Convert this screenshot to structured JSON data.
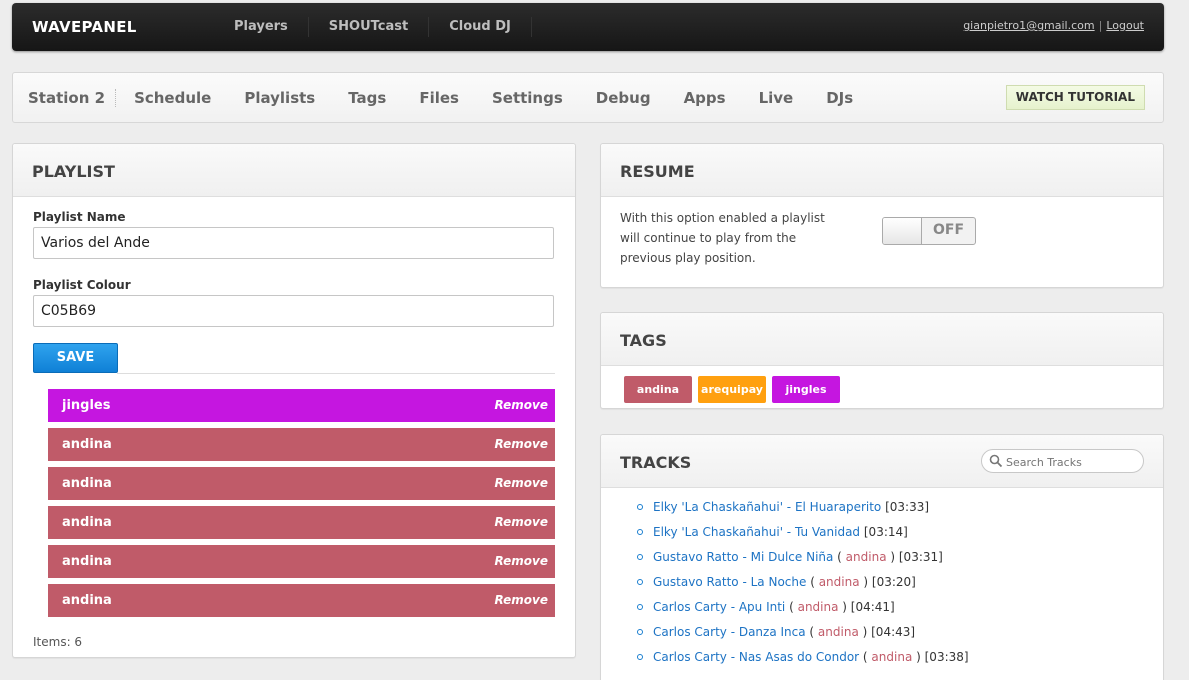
{
  "topbar": {
    "brand": "WAVEPANEL",
    "nav": [
      "Players",
      "SHOUTcast",
      "Cloud DJ"
    ],
    "email": "gianpietro1@gmail.com",
    "separator": "|",
    "logout": "Logout"
  },
  "subnav": {
    "station": "Station 2",
    "items": [
      "Schedule",
      "Playlists",
      "Tags",
      "Files",
      "Settings",
      "Debug",
      "Apps",
      "Live",
      "DJs"
    ],
    "tutorial": "WATCH TUTORIAL"
  },
  "playlist": {
    "title": "PLAYLIST",
    "name_label": "Playlist Name",
    "name_value": "Varios del Ande",
    "colour_label": "Playlist Colour",
    "colour_value": "C05B69",
    "save_label": "SAVE",
    "remove_label": "Remove",
    "items": [
      {
        "name": "jingles",
        "color": "#c516e0"
      },
      {
        "name": "andina",
        "color": "#c05b69"
      },
      {
        "name": "andina",
        "color": "#c05b69"
      },
      {
        "name": "andina",
        "color": "#c05b69"
      },
      {
        "name": "andina",
        "color": "#c05b69"
      },
      {
        "name": "andina",
        "color": "#c05b69"
      }
    ],
    "count": "Items: 6"
  },
  "resume": {
    "title": "RESUME",
    "description": "With this option enabled a playlist will continue to play from the previous play position.",
    "toggle_state": "OFF"
  },
  "tags": {
    "title": "TAGS",
    "items": [
      {
        "name": "andina",
        "color": "#c05b69"
      },
      {
        "name": "arequipay",
        "color": "#ffa00f"
      },
      {
        "name": "jingles",
        "color": "#c516e0"
      }
    ]
  },
  "tracks": {
    "title": "TRACKS",
    "search_placeholder": "Search Tracks",
    "items": [
      {
        "title": "Elky 'La Chaskañahui' - El Huaraperito",
        "tag": "",
        "duration": "[03:33]"
      },
      {
        "title": "Elky 'La Chaskañahui' - Tu Vanidad",
        "tag": "",
        "duration": "[03:14]"
      },
      {
        "title": "Gustavo Ratto - Mi Dulce Niña",
        "tag": "andina",
        "duration": "[03:31]"
      },
      {
        "title": "Gustavo Ratto - La Noche",
        "tag": "andina",
        "duration": "[03:20]"
      },
      {
        "title": "Carlos Carty - Apu Inti",
        "tag": "andina",
        "duration": "[04:41]"
      },
      {
        "title": "Carlos Carty - Danza Inca",
        "tag": "andina",
        "duration": "[04:43]"
      },
      {
        "title": "Carlos Carty - Nas Asas do Condor",
        "tag": "andina",
        "duration": "[03:38]"
      }
    ]
  },
  "colors": {
    "accent_blue": "#1d73c4",
    "save_blue": "#1a8fe3",
    "tag_andina": "#c05b69",
    "tag_arequipay": "#ffa00f",
    "tag_jingles": "#c516e0"
  }
}
